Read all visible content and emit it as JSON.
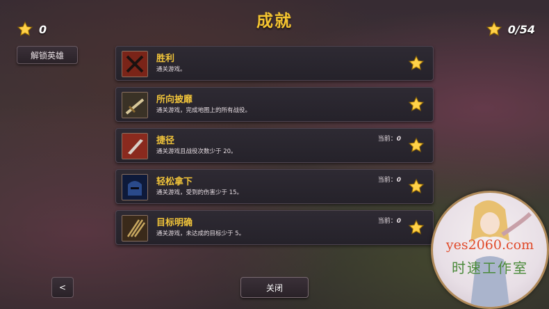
{
  "header": {
    "title": "成就"
  },
  "stats": {
    "coins": "0",
    "stars": "0/54"
  },
  "buttons": {
    "unlock_heroes": "解锁英雄",
    "back": "<",
    "close": "关闭"
  },
  "achievements": [
    {
      "title": "胜利",
      "desc": "通关游戏。",
      "current": "",
      "icon": "crossed-swords-icon"
    },
    {
      "title": "所向披靡",
      "desc": "通关游戏，完成地图上的所有战役。",
      "current": "",
      "icon": "sword-icon"
    },
    {
      "title": "捷径",
      "desc": "通关游戏且战役次数少于 20。",
      "current_label": "当前：",
      "current": "0",
      "icon": "blade-icon"
    },
    {
      "title": "轻松拿下",
      "desc": "通关游戏，受到的伤害少于 15。",
      "current_label": "当前：",
      "current": "0",
      "icon": "helmet-icon"
    },
    {
      "title": "目标明确",
      "desc": "通关游戏，未达成的目标少于 5。",
      "current_label": "当前：",
      "current": "0",
      "icon": "arrows-icon"
    }
  ],
  "watermark": {
    "line1": "yes2060.com",
    "line2": "时速工作室"
  },
  "colors": {
    "accent": "#f4c430",
    "panel": "#2e2a33"
  }
}
